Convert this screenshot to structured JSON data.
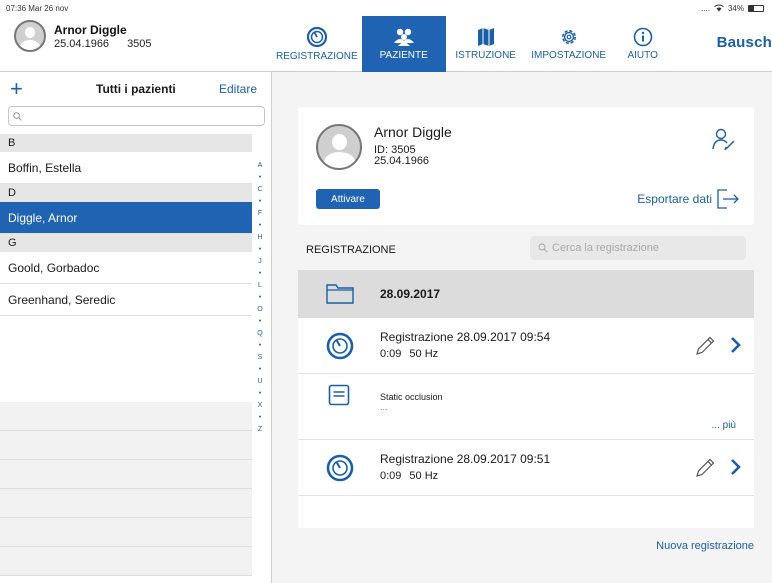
{
  "status_bar": {
    "time": "07:36",
    "date": "Mar 26 nov",
    "signal": "....",
    "battery": "34%",
    "battery_level": 0.34
  },
  "patient": {
    "name": "Arnor Diggle",
    "dob": "25.04.1966",
    "id": "3505",
    "id_label": "ID: 3505"
  },
  "tabs": [
    {
      "label": "REGISTRAZIONE",
      "icon": "gauge-icon",
      "active": false
    },
    {
      "label": "PAZIENTE",
      "icon": "people-icon",
      "active": true
    },
    {
      "label": "ISTRUZIONE",
      "icon": "map-icon",
      "active": false
    },
    {
      "label": "IMPOSTAZIONE",
      "icon": "gear-icon",
      "active": false
    },
    {
      "label": "AIUTO",
      "icon": "info-icon",
      "active": false
    }
  ],
  "brand": "Bausch",
  "sidebar": {
    "add_icon": "+",
    "title": "Tutti i pazienti",
    "edit_label": "Editare",
    "search_placeholder": "",
    "sections": [
      {
        "letter": "B",
        "patients": [
          "Boffin, Estella"
        ]
      },
      {
        "letter": "D",
        "patients": [
          "Diggle, Arnor"
        ]
      },
      {
        "letter": "G",
        "patients": [
          "Goold, Gorbadoc",
          "Greenhand, Seredic"
        ]
      }
    ],
    "selected": "Diggle, Arnor",
    "index": [
      "A",
      "•",
      "C",
      "•",
      "F",
      "•",
      "H",
      "•",
      "J",
      "•",
      "L",
      "•",
      "O",
      "•",
      "Q",
      "•",
      "S",
      "•",
      "U",
      "•",
      "X",
      "•",
      "Z"
    ]
  },
  "card": {
    "activate_label": "Attivare",
    "export_label": "Esportare dati"
  },
  "recordings": {
    "title": "REGISTRAZIONE",
    "search_placeholder": "Cerca la registrazione",
    "folder_date": "28.09.2017",
    "items": [
      {
        "title": "Registrazione 28.09.2017 09:54",
        "duration": "0:09",
        "freq": "50 Hz"
      },
      {
        "title": "Registrazione 28.09.2017 09:51",
        "duration": "0:09",
        "freq": "50 Hz"
      }
    ],
    "note": {
      "title": "Static occlusion",
      "detail": "...",
      "more": "... più"
    },
    "new_label": "Nuova registrazione"
  },
  "colors": {
    "accent": "#1f63b2",
    "link": "#1a5fa8",
    "section_bg": "#e6e6e6",
    "folder_bg": "#dcdcdc",
    "main_bg": "#f4f4f4"
  }
}
